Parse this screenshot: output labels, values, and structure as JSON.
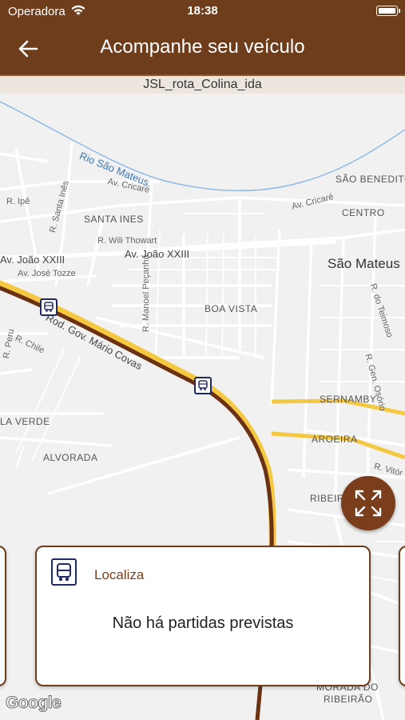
{
  "status_bar": {
    "carrier": "Operadora",
    "time": "18:38"
  },
  "header": {
    "title": "Acompanhe seu veículo",
    "route": "JSL_rota_Colina_ida"
  },
  "map": {
    "labels": {
      "river": "Rio São Mateus",
      "av_cricare_1": "Av. Cricaré",
      "av_cricare_2": "Av. Cricaré",
      "sao_benedito": "SÃO BENEDITO",
      "centro": "CENTRO",
      "r_ipe": "R. Ipê",
      "r_santa_ines": "R. Santa Inês",
      "santa_ines": "SANTA INES",
      "r_wili": "R. Wili Thowart",
      "av_joao_1": "Av. João XXIII",
      "av_joao_2": "Av. João XXIII",
      "sao_mateus": "São Mateus",
      "av_jose": "Av. José Tozze",
      "r_manoel": "R. Manoel Peçanha",
      "boa_vista": "BOA VISTA",
      "highway": "Rod. Gov. Mário Covas",
      "r_chile": "R. Chile",
      "r_peru": "R. Peru",
      "r_teimoso": "R. do Teimoso",
      "r_gen": "R. Gen. Osório",
      "sernamby": "SERNAMBY",
      "aroeira": "AROEIRA",
      "la_verde": "LA VERDE",
      "alvorada": "ALVORADA",
      "r_vitor": "R. Vitór",
      "ribeira": "RIBEIRA",
      "morada": "MORADA DO",
      "ribeirao": "RIBEIRÃO"
    },
    "google_logo": "Google"
  },
  "card": {
    "stop_name": "Localiza",
    "message": "Não há partidas previstas"
  },
  "colors": {
    "brand": "#6e3d1c",
    "route": "#7a3e1d",
    "highway": "#f5c842",
    "stop_border": "#1f2a63"
  }
}
